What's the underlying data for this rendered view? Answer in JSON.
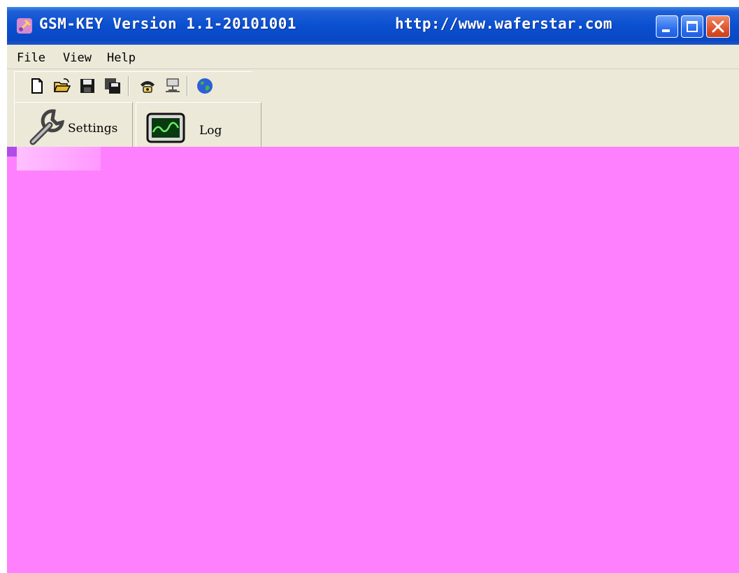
{
  "window": {
    "title": "GSM-KEY Version 1.1-20101001",
    "url": "http://www.waferstar.com"
  },
  "menu": {
    "items": [
      "File",
      "View",
      "Help"
    ]
  },
  "toolbar": {
    "buttons": [
      {
        "icon": "new-file-icon"
      },
      {
        "icon": "open-folder-icon"
      },
      {
        "icon": "save-icon"
      },
      {
        "icon": "save-all-icon"
      },
      {
        "icon": "dial-phone-icon"
      },
      {
        "icon": "network-icon"
      },
      {
        "icon": "globe-icon"
      }
    ]
  },
  "tabs": [
    {
      "label": "Settings",
      "icon": "wrench-icon"
    },
    {
      "label": "Log",
      "icon": "oscilloscope-icon"
    }
  ],
  "colors": {
    "titlebar": "#0a4fd0",
    "chrome": "#ece9d8",
    "content": "#ff80ff"
  }
}
